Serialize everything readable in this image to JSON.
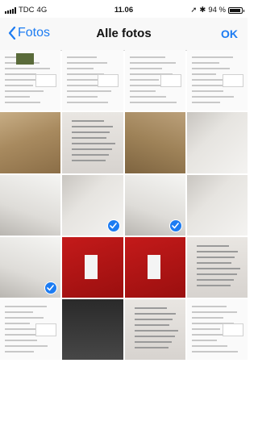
{
  "status_bar": {
    "carrier": "TDC",
    "network": "4G",
    "time": "11.06",
    "battery": "94 %",
    "battery_level": 0.94
  },
  "nav": {
    "back_label": "Fotos",
    "title": "Alle fotos",
    "done_label": "OK"
  },
  "photos": [
    {
      "kind": "screenshot",
      "selected": false
    },
    {
      "kind": "screenshot",
      "selected": false
    },
    {
      "kind": "screenshot",
      "selected": false
    },
    {
      "kind": "screenshot",
      "selected": false
    },
    {
      "kind": "cardboard-box",
      "selected": false
    },
    {
      "kind": "document",
      "selected": false
    },
    {
      "kind": "cardboard-box",
      "selected": false
    },
    {
      "kind": "white-box",
      "selected": false
    },
    {
      "kind": "white-box",
      "selected": false
    },
    {
      "kind": "white-box",
      "selected": true
    },
    {
      "kind": "white-box",
      "selected": true
    },
    {
      "kind": "white-box",
      "selected": false
    },
    {
      "kind": "white-box",
      "selected": true
    },
    {
      "kind": "red-box",
      "selected": false
    },
    {
      "kind": "red-box",
      "selected": false
    },
    {
      "kind": "document",
      "selected": false
    },
    {
      "kind": "screenshot",
      "selected": false
    },
    {
      "kind": "keyboard",
      "selected": false
    },
    {
      "kind": "document",
      "selected": false
    },
    {
      "kind": "screenshot",
      "selected": false
    }
  ],
  "colors": {
    "accent": "#1d7cf2"
  }
}
